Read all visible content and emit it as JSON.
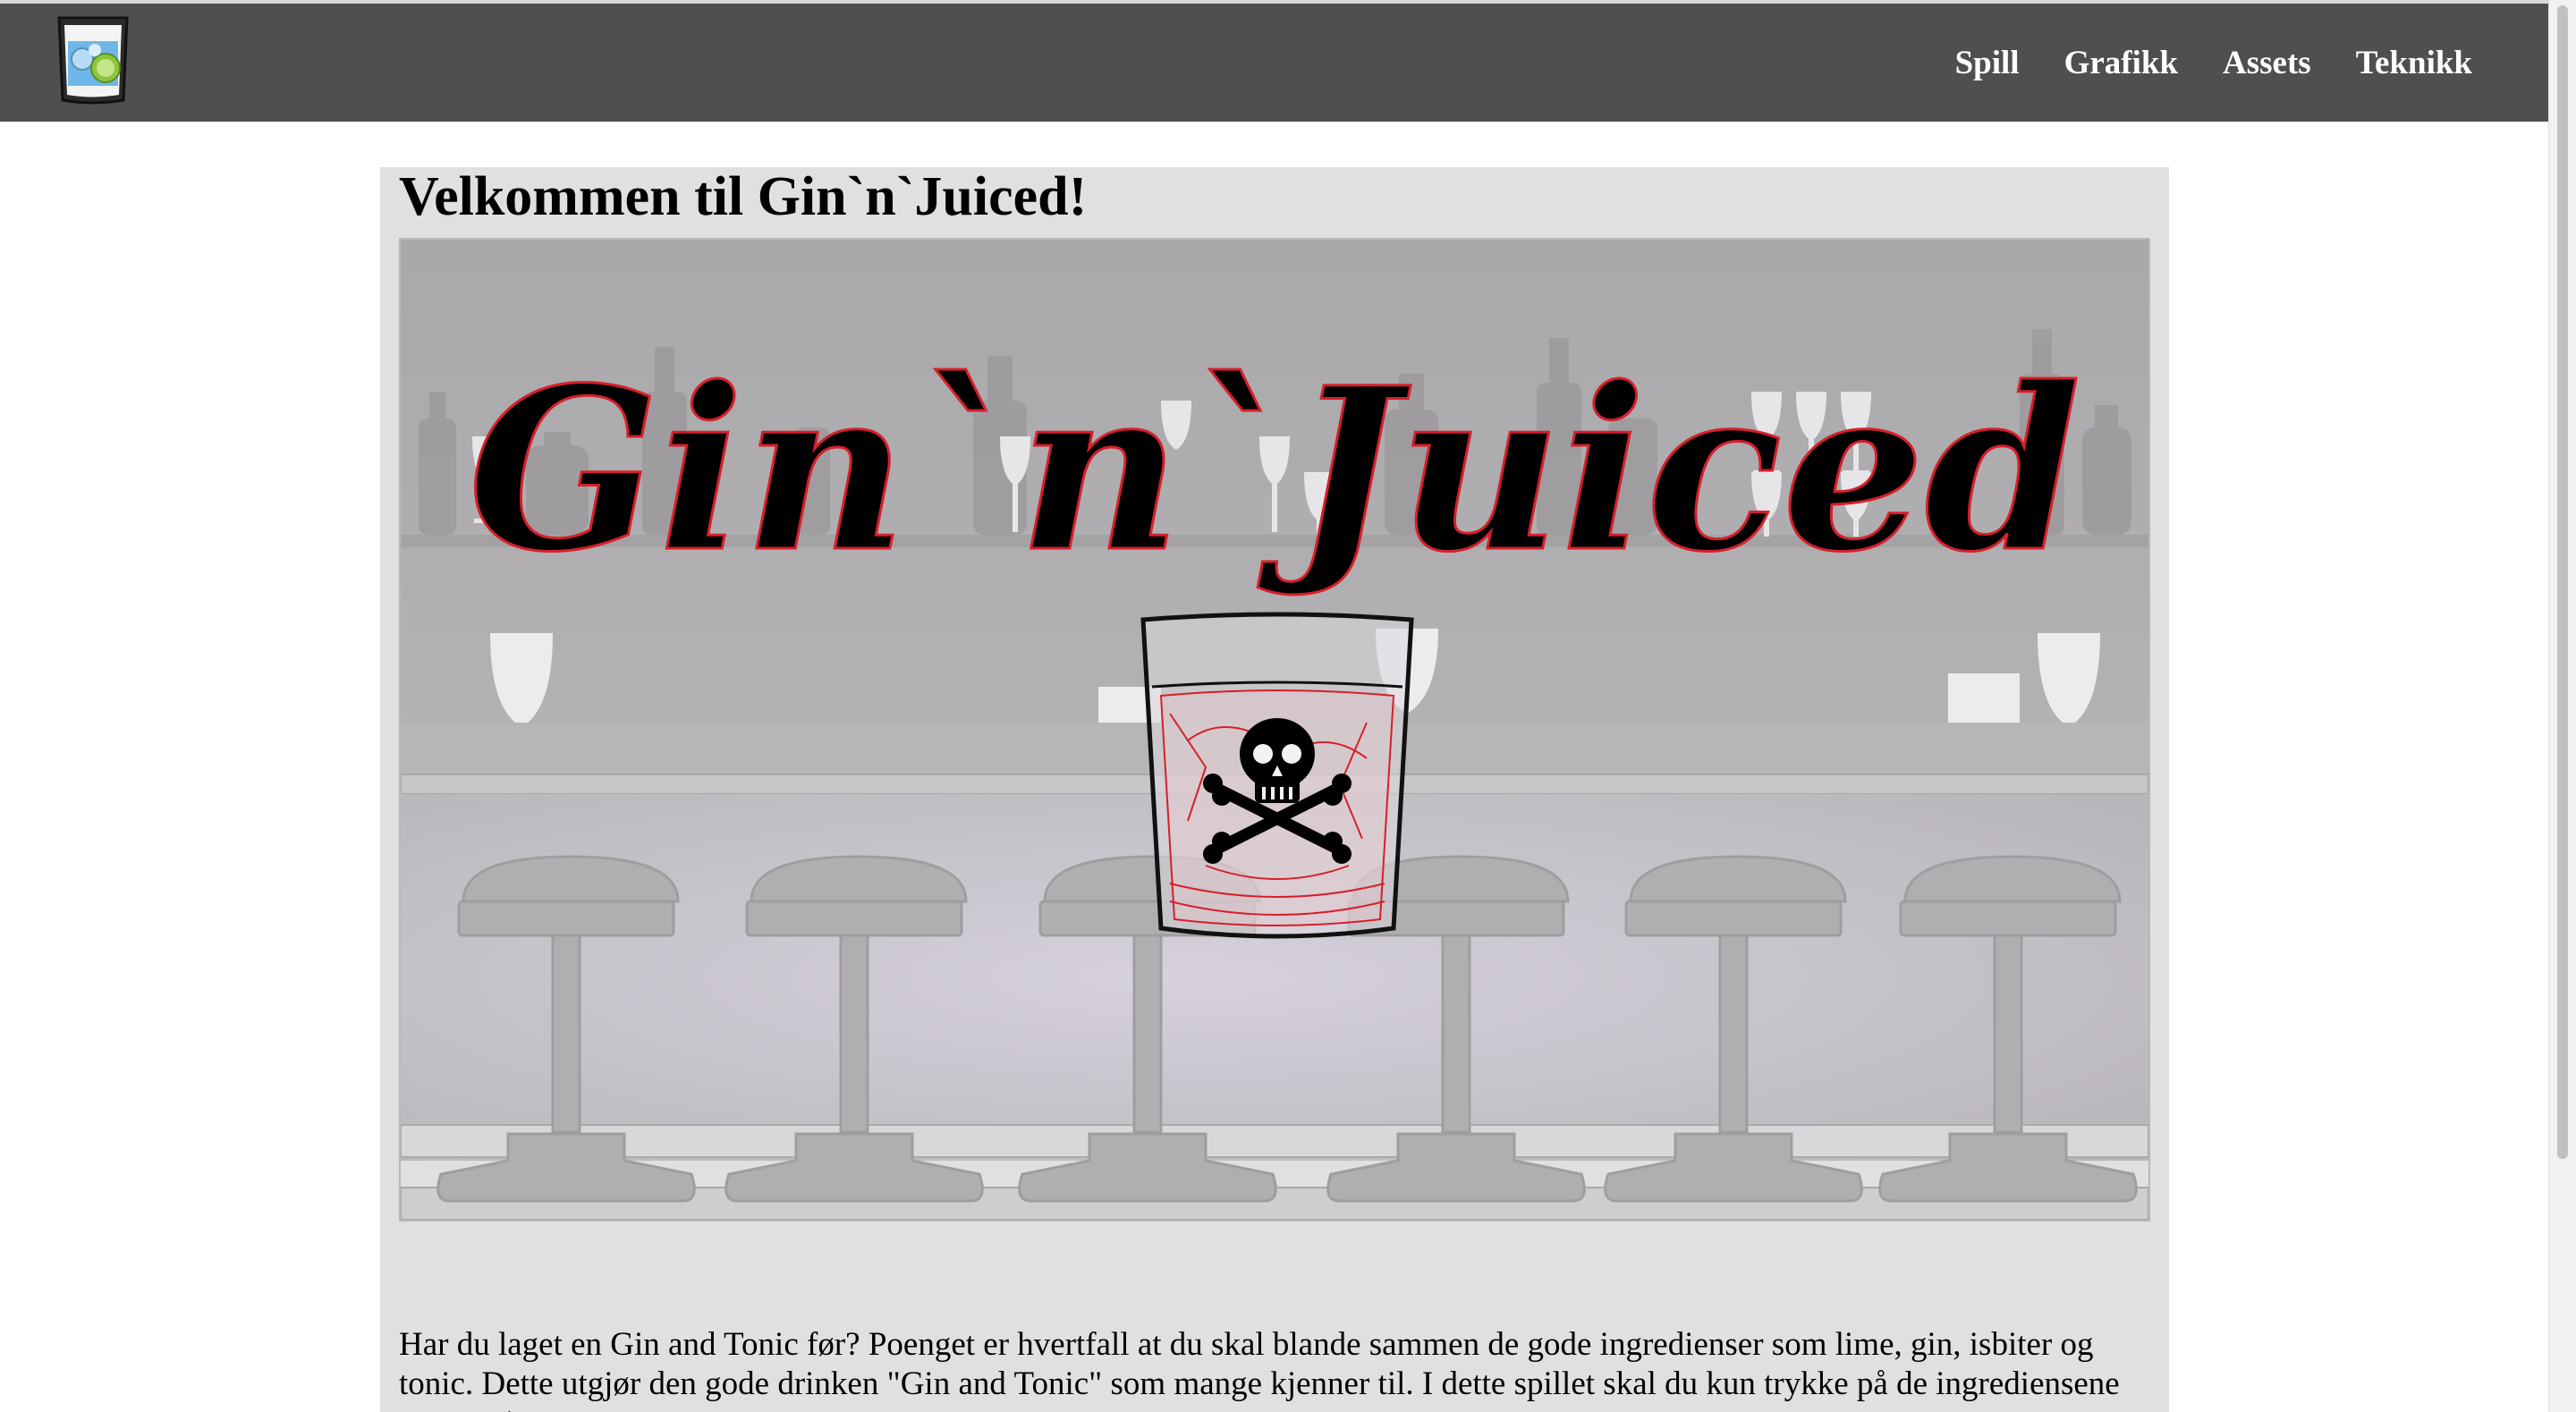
{
  "nav": {
    "items": [
      {
        "label": "Spill"
      },
      {
        "label": "Grafikk"
      },
      {
        "label": "Assets"
      },
      {
        "label": "Teknikk"
      }
    ]
  },
  "main": {
    "title": "Velkommen til Gin`n`Juiced!",
    "hero": {
      "logo_text": "Gin`n`Juiced",
      "icon": "skull-crossbones-icon"
    },
    "intro": "Har du laget en Gin and Tonic før? Poenget er hvertfall at du skal blande sammen de gode ingredienser som lime, gin, isbiter og tonic. Dette utgjør den gode drinken \"Gin and Tonic\" som mange kjenner til. I dette spillet skal du kun trykke på de ingrediensene som utgjør"
  },
  "colors": {
    "navbar": "#4f4f4f",
    "content_bg": "#e1dfe0",
    "logo_stroke": "#d61f2a"
  }
}
